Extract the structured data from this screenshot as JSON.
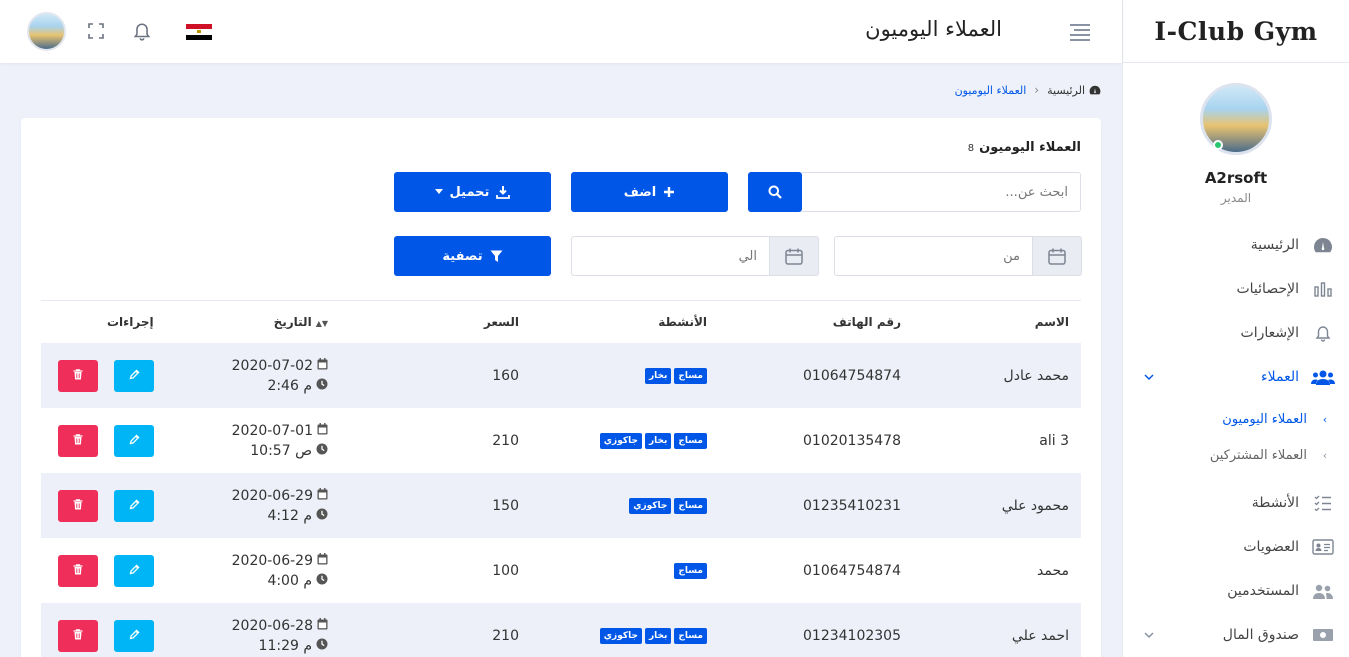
{
  "brand": "I-Club Gym",
  "user": {
    "name": "A2rsoft",
    "role": "المدير"
  },
  "menu": {
    "home": "الرئيسية",
    "stats": "الإحصائيات",
    "notifications": "الإشعارات",
    "clients": "العملاء",
    "daily_clients": "العملاء اليوميون",
    "subscribed_clients": "العملاء المشتركين",
    "activities": "الأنشطة",
    "memberships": "العضويات",
    "users": "المستخدمين",
    "cashbox": "صندوق المال"
  },
  "topbar": {
    "title": "العملاء اليوميون"
  },
  "breadcrumb": {
    "home": "الرئيسية",
    "current": "العملاء اليوميون"
  },
  "card": {
    "title": "العملاء اليوميون",
    "count": "8",
    "search_placeholder": "ابحث عن...",
    "add_label": "اضف",
    "download_label": "تحميل",
    "from_placeholder": "من",
    "to_placeholder": "الي",
    "filter_label": "تصفية"
  },
  "table": {
    "headers": {
      "name": "الاسم",
      "phone": "رقم الهاتف",
      "activities": "الأنشطة",
      "price": "السعر",
      "date": "التاريخ",
      "actions": "إجراءات"
    },
    "rows": [
      {
        "name": "محمد عادل",
        "phone": "01064754874",
        "activities": [
          "مساج",
          "بخار"
        ],
        "price": "160",
        "date": "2020-07-02",
        "time": "2:46 م"
      },
      {
        "name": "ali 3",
        "phone": "01020135478",
        "activities": [
          "مساج",
          "بخار",
          "جاكوزي"
        ],
        "price": "210",
        "date": "2020-07-01",
        "time": "10:57 ص"
      },
      {
        "name": "محمود علي",
        "phone": "01235410231",
        "activities": [
          "مساج",
          "جاكوزي"
        ],
        "price": "150",
        "date": "2020-06-29",
        "time": "4:12 م"
      },
      {
        "name": "محمد",
        "phone": "01064754874",
        "activities": [
          "مساج"
        ],
        "price": "100",
        "date": "2020-06-29",
        "time": "4:00 م"
      },
      {
        "name": "احمد علي",
        "phone": "01234102305",
        "activities": [
          "مساج",
          "بخار",
          "جاكوزي"
        ],
        "price": "210",
        "date": "2020-06-28",
        "time": "11:29 م"
      }
    ]
  },
  "colors": {
    "primary": "#0057e7",
    "edit": "#00b5f5",
    "delete": "#ef2f59",
    "stripe": "#edf0f9"
  }
}
